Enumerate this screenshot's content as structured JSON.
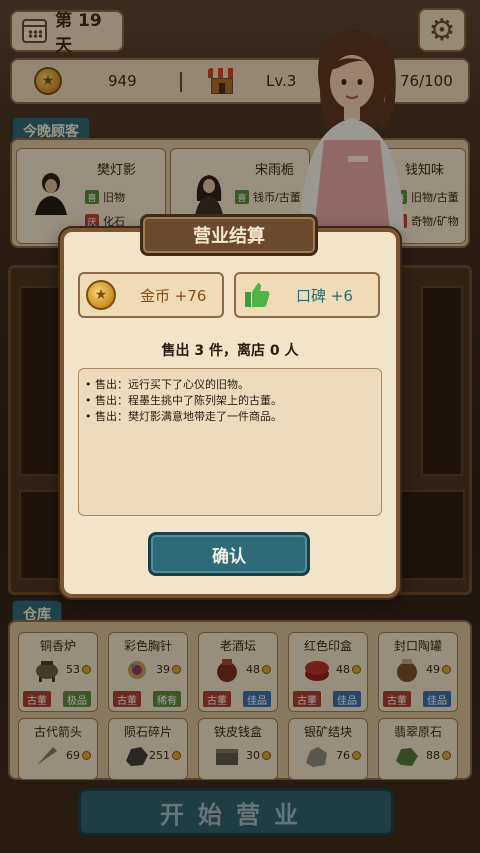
{
  "header": {
    "day_label": "第 19 天",
    "coins": "949",
    "level": "Lv.3",
    "capacity": "76/100"
  },
  "guests": {
    "section_label": "今晚顾客",
    "list": [
      {
        "name": "樊灯影",
        "like": "旧物",
        "dislike": "化石",
        "like_tag": "喜",
        "dislike_tag": "厌"
      },
      {
        "name": "宋雨栀",
        "like": "钱币/古董",
        "dislike": "",
        "like_tag": "喜",
        "dislike_tag": "厌"
      },
      {
        "name": "钱知味",
        "like": "旧物/古董",
        "dislike": "奇物/矿物",
        "like_tag": "喜",
        "dislike_tag": "厌"
      }
    ]
  },
  "modal": {
    "title": "营业结算",
    "coin_reward": "金币 +76",
    "rep_reward": "口碑 +6",
    "summary": "售出 3 件，离店 0 人",
    "log": [
      "• 售出：远行买下了心仪的旧物。",
      "• 售出：程墨生挑中了陈列架上的古董。",
      "• 售出：樊灯影满意地带走了一件商品。"
    ],
    "confirm_label": "确认"
  },
  "warehouse": {
    "section_label": "仓库",
    "items_row1": [
      {
        "name": "铜香炉",
        "price": "53",
        "tags": [
          "古董",
          "极品"
        ],
        "tag_colors": [
          "red",
          "green"
        ]
      },
      {
        "name": "彩色胸针",
        "price": "39",
        "tags": [
          "古董",
          "稀有"
        ],
        "tag_colors": [
          "red",
          "green"
        ]
      },
      {
        "name": "老酒坛",
        "price": "48",
        "tags": [
          "古董",
          "佳品"
        ],
        "tag_colors": [
          "red",
          "blue"
        ]
      },
      {
        "name": "红色印盒",
        "price": "48",
        "tags": [
          "古董",
          "佳品"
        ],
        "tag_colors": [
          "red",
          "blue"
        ]
      },
      {
        "name": "封口陶罐",
        "price": "49",
        "tags": [
          "古董",
          "佳品"
        ],
        "tag_colors": [
          "red",
          "blue"
        ]
      }
    ],
    "items_row2": [
      {
        "name": "古代箭头",
        "price": "69"
      },
      {
        "name": "陨石碎片",
        "price": "251"
      },
      {
        "name": "铁皮钱盒",
        "price": "30"
      },
      {
        "name": "银矿结块",
        "price": "76"
      },
      {
        "name": "翡翠原石",
        "price": "88"
      }
    ]
  },
  "start_button_label": "开始营业",
  "icons": {
    "calendar": "calendar-icon",
    "settings": "gear-icon",
    "coin": "coin-icon",
    "shop": "shop-icon",
    "thumb": "thumbs-up-icon"
  },
  "colors": {
    "teal": "#2e6b78",
    "parchment": "#f1e4c8",
    "wood": "#6b4a2e"
  }
}
